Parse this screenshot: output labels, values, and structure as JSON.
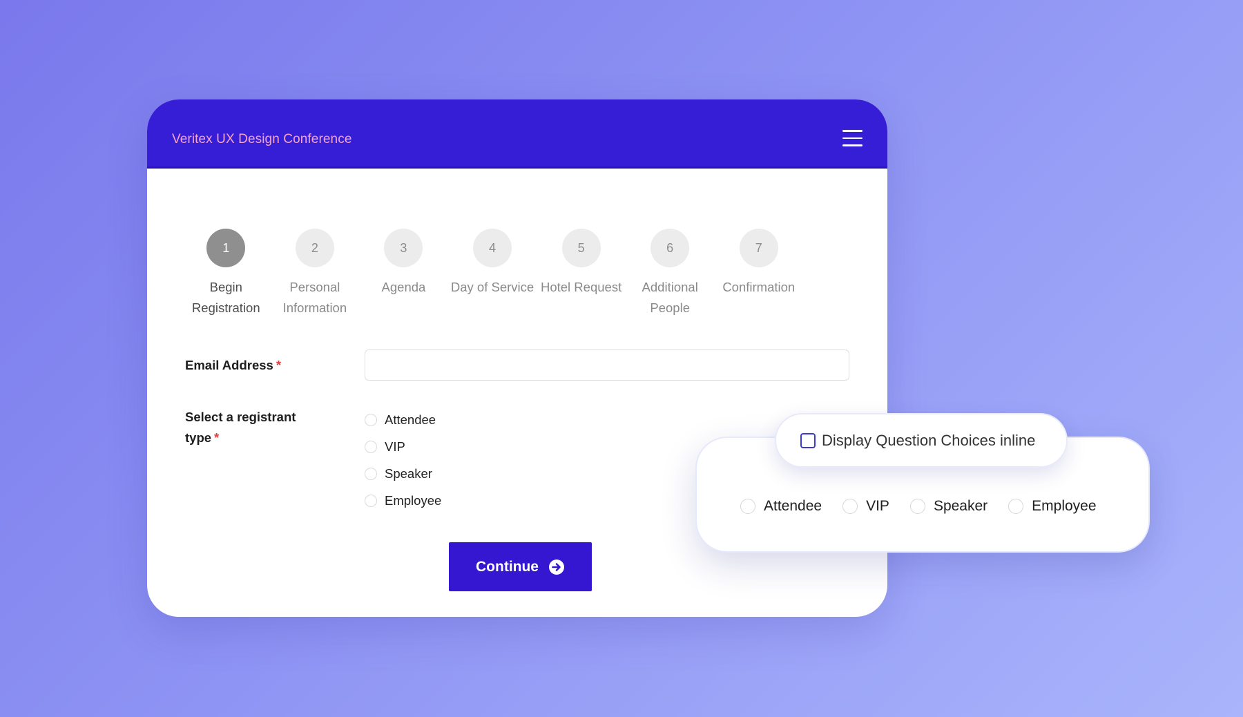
{
  "app": {
    "brand": "Veritex UX Design Conference"
  },
  "steps": [
    {
      "number": "1",
      "label": "Begin Registration",
      "active": true
    },
    {
      "number": "2",
      "label": "Personal Information",
      "active": false
    },
    {
      "number": "3",
      "label": "Agenda",
      "active": false
    },
    {
      "number": "4",
      "label": "Day of Service",
      "active": false
    },
    {
      "number": "5",
      "label": "Hotel Request",
      "active": false
    },
    {
      "number": "6",
      "label": "Additional People",
      "active": false
    },
    {
      "number": "7",
      "label": "Confirmation",
      "active": false
    }
  ],
  "form": {
    "email_label": "Email Address",
    "required_mark": "*",
    "email_value": "",
    "registrant_label": "Select a registrant type",
    "registrant_options": [
      "Attendee",
      "VIP",
      "Speaker",
      "Employee"
    ],
    "continue_label": "Continue"
  },
  "inline_setting": {
    "checkbox_label": "Display Question Choices inline",
    "checked": false,
    "options": [
      "Attendee",
      "VIP",
      "Speaker",
      "Employee"
    ]
  },
  "colors": {
    "header": "#361ed6",
    "brand_text": "#f5a3c7",
    "button": "#3516d1",
    "required": "#e23b3b"
  },
  "icons": {
    "menu": "hamburger-menu-icon",
    "continue": "arrow-circle-right-icon"
  }
}
